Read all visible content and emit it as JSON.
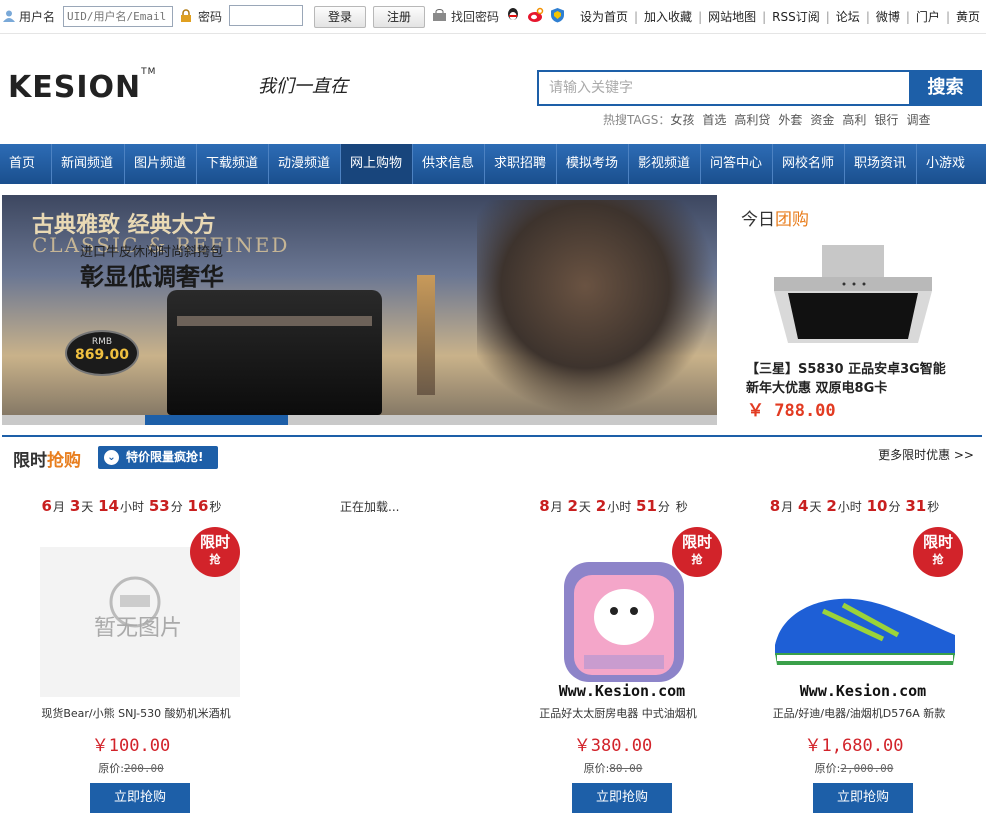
{
  "topbar": {
    "username_label": "用户名",
    "username_placeholder": "UID/用户名/Email",
    "password_label": "密码",
    "login_button": "登录",
    "register_button": "注册",
    "forgot_password": "找回密码",
    "links": [
      "设为首页",
      "加入收藏",
      "网站地图",
      "RSS订阅",
      "论坛",
      "微博",
      "门户",
      "黄页"
    ]
  },
  "header": {
    "logo": "KESION",
    "logo_tm": "TM",
    "slogan": "我们一直在",
    "search_placeholder": "请输入关键字",
    "search_button": "搜索",
    "hot_label": "热搜TAGS：",
    "hot_tags": [
      "女孩",
      "首选",
      "高利贷",
      "外套",
      "资金",
      "高利",
      "银行",
      "调查"
    ]
  },
  "nav": {
    "items": [
      "首页",
      "新闻频道",
      "图片频道",
      "下载频道",
      "动漫频道",
      "网上购物",
      "供求信息",
      "求职招聘",
      "模拟考场",
      "影视频道",
      "问答中心",
      "网校名师",
      "职场资讯",
      "小游戏"
    ],
    "active_index": 5
  },
  "banner": {
    "headline_1": "古典雅致 经典大方",
    "headline_2": "CLASSIC & REFINED",
    "sub": "进口牛皮休闲时尚斜挎包",
    "headline_3": "彰显低调奢华",
    "price_unit": "RMB",
    "price": "869.00",
    "slide_count": 5,
    "active_slide": 1
  },
  "group_buy": {
    "title_a": "今日",
    "title_b": "团购",
    "name": "【三星】S5830 正品安卓3G智能 新年大优惠 双原电8G卡",
    "price": "￥ 788.00"
  },
  "flash_sale": {
    "title_a": "限时",
    "title_b": "抢购",
    "badge": "特价限量疯抢!",
    "more": "更多限时优惠 >>",
    "loading": "正在加载...",
    "tag_top": "限时",
    "tag_bottom": "抢",
    "no_image": "暂无图片",
    "watermark": "Www.Kesion.com",
    "orig_label": "原价:",
    "buy_label": "立即抢购",
    "unit_month": "月",
    "unit_day": "天",
    "unit_hour": "小时",
    "unit_min": "分",
    "unit_sec": "秒",
    "items": [
      {
        "month": "6",
        "day": "3",
        "hour": "14",
        "min": "53",
        "sec": "16",
        "name": "现货Bear/小熊 SNJ-530 酸奶机米酒机",
        "price": "￥100.00",
        "orig": "200.00"
      },
      {
        "month": "8",
        "day": "2",
        "hour": "2",
        "min": "51",
        "sec": "",
        "name": "正品好太太厨房电器 中式油烟机",
        "price": "￥380.00",
        "orig": "80.00"
      },
      {
        "month": "8",
        "day": "4",
        "hour": "2",
        "min": "10",
        "sec": "31",
        "name": "正品/好迪/电器/油烟机D576A 新款",
        "price": "￥1,680.00",
        "orig": "2,000.00"
      }
    ]
  },
  "colors": {
    "brand_blue": "#1d5fa8",
    "accent_orange": "#e87e1e",
    "price_red": "#d2232a"
  }
}
